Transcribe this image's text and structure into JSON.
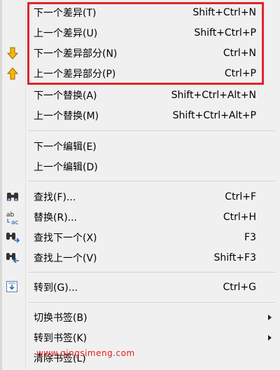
{
  "menu": {
    "items": [
      {
        "label": "下一个差异(T)",
        "shortcut": "Shift+Ctrl+N",
        "icon": ""
      },
      {
        "label": "上一个差异(U)",
        "shortcut": "Shift+Ctrl+P",
        "icon": ""
      },
      {
        "label": "下一个差异部分(N)",
        "shortcut": "Ctrl+N",
        "icon": "arrow-down-icon"
      },
      {
        "label": "上一个差异部分(P)",
        "shortcut": "Ctrl+P",
        "icon": "arrow-up-icon"
      },
      {
        "label": "下一个替换(A)",
        "shortcut": "Shift+Ctrl+Alt+N",
        "icon": ""
      },
      {
        "label": "上一个替换(M)",
        "shortcut": "Shift+Ctrl+Alt+P",
        "icon": ""
      },
      {
        "label": "下一个编辑(E)",
        "shortcut": "",
        "icon": ""
      },
      {
        "label": "上一个编辑(D)",
        "shortcut": "",
        "icon": ""
      },
      {
        "label": "查找(F)...",
        "shortcut": "Ctrl+F",
        "icon": "binoculars-icon"
      },
      {
        "label": "替换(R)...",
        "shortcut": "Ctrl+H",
        "icon": "replace-icon"
      },
      {
        "label": "查找下一个(X)",
        "shortcut": "F3",
        "icon": "find-next-icon"
      },
      {
        "label": "查找上一个(V)",
        "shortcut": "Shift+F3",
        "icon": "find-previous-icon"
      },
      {
        "label": "转到(G)...",
        "shortcut": "Ctrl+G",
        "icon": "goto-icon"
      },
      {
        "label": "切换书签(B)",
        "shortcut": "",
        "icon": "",
        "submenu": true
      },
      {
        "label": "转到书签(K)",
        "shortcut": "",
        "icon": "",
        "submenu": true
      },
      {
        "label": "清除书签(L)",
        "shortcut": "",
        "icon": ""
      }
    ]
  },
  "icon_glyphs": {
    "replace_top": "ab",
    "replace_bottom": "ac"
  },
  "watermark": "www.qingsimeng.com",
  "colors": {
    "highlight_border": "#e0252c",
    "arrow_fill": "#f5b800",
    "watermark": "#e02020"
  }
}
